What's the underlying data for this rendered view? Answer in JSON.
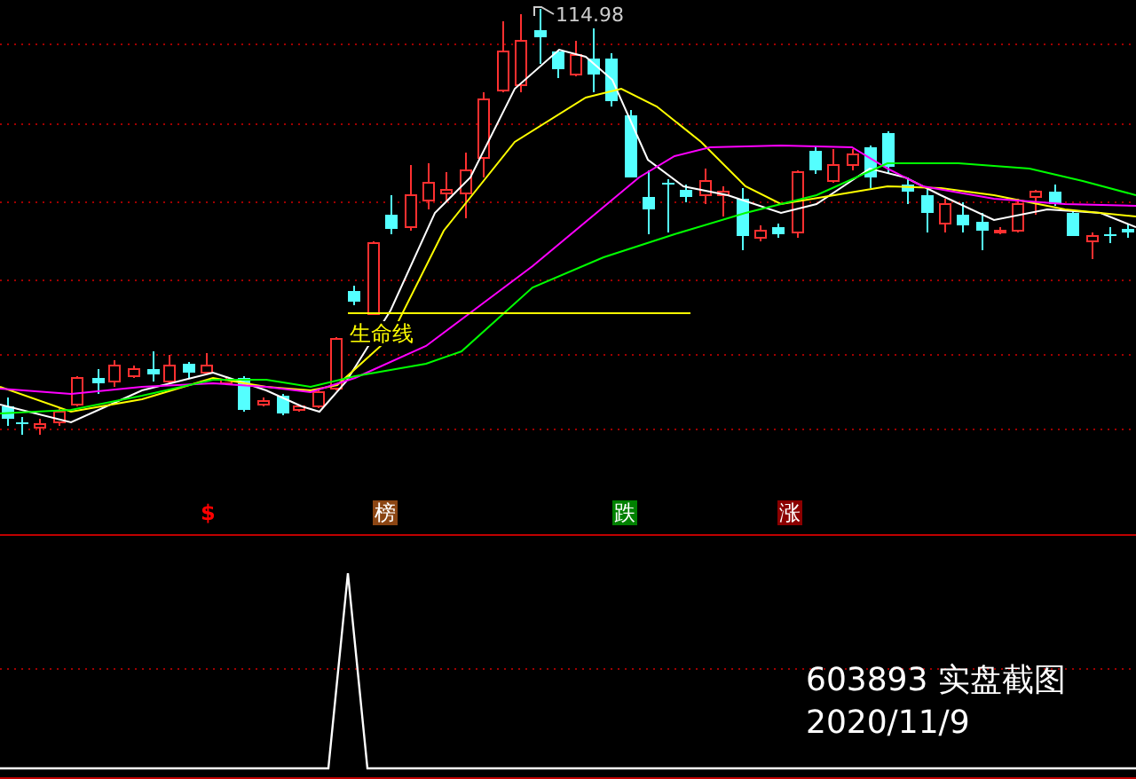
{
  "main_chart": {
    "price_label": "114.98",
    "life_line_label": "生命线"
  },
  "signals": [
    {
      "label": "$",
      "kind": "text",
      "color": "#ff0000"
    },
    {
      "label": "榜",
      "kind": "badge",
      "color": "#8b4513"
    },
    {
      "label": "跌",
      "kind": "badge",
      "color": "#008000"
    },
    {
      "label": "涨",
      "kind": "badge",
      "color": "#8b0000"
    }
  ],
  "caption": {
    "code": "603893 实盘截图",
    "date": "2020/11/9"
  }
}
